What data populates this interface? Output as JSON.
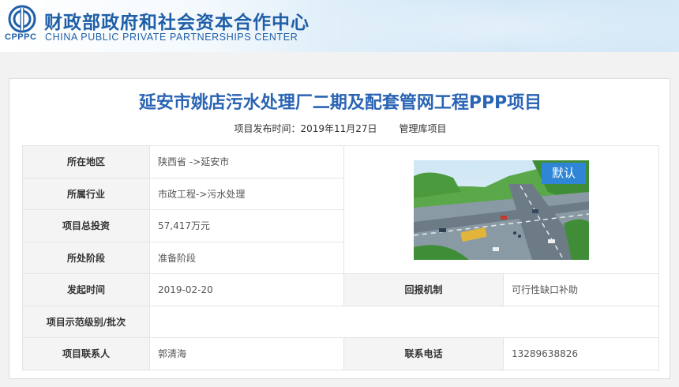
{
  "header": {
    "logo_abbr": "CPPPC",
    "org_name_cn": "财政部政府和社会资本合作中心",
    "org_name_en": "CHINA PUBLIC PRIVATE PARTNERSHIPS CENTER",
    "logo_icon": "cpppc-logo-icon",
    "brand_color": "#1f5fa8"
  },
  "project": {
    "title": "延安市姚店污水处理厂二期及配套管网工程PPP项目",
    "publish_label": "项目发布时间：",
    "publish_date": "2019年11月27日",
    "category": "管理库项目",
    "image_badge": "默认"
  },
  "details": {
    "region_label": "所在地区",
    "region_value": "陕西省 ->延安市",
    "industry_label": "所属行业",
    "industry_value": "市政工程->污水处理",
    "investment_label": "项目总投资",
    "investment_value": "57,417万元",
    "stage_label": "所处阶段",
    "stage_value": "准备阶段",
    "launch_label": "发起时间",
    "launch_value": "2019-02-20",
    "return_label": "回报机制",
    "return_value": "可行性缺口补助",
    "demo_label": "项目示范级别/批次",
    "demo_value": "",
    "contact_label": "项目联系人",
    "contact_value": "郭清海",
    "phone_label": "联系电话",
    "phone_value": "13289638826"
  }
}
